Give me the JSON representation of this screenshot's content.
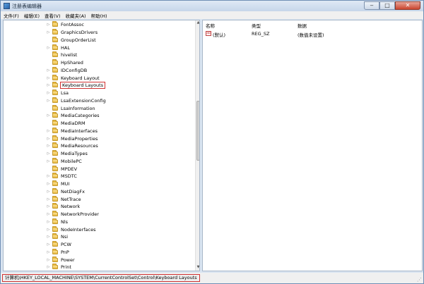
{
  "window": {
    "title": "注册表编辑器",
    "controls": {
      "minimize": "‒",
      "maximize": "□",
      "close": "✕"
    }
  },
  "menu": [
    "文件(F)",
    "编辑(E)",
    "查看(V)",
    "收藏夹(A)",
    "帮助(H)"
  ],
  "tree": {
    "items": [
      {
        "label": "FontAssoc",
        "expandable": true
      },
      {
        "label": "GraphicsDrivers",
        "expandable": true
      },
      {
        "label": "GroupOrderList",
        "expandable": false
      },
      {
        "label": "HAL",
        "expandable": true
      },
      {
        "label": "hivelist",
        "expandable": false
      },
      {
        "label": "HpShared",
        "expandable": false
      },
      {
        "label": "IDConfigDB",
        "expandable": true
      },
      {
        "label": "Keyboard Layout",
        "expandable": true
      },
      {
        "label": "Keyboard Layouts",
        "expandable": true,
        "selected": true
      },
      {
        "label": "Lsa",
        "expandable": true
      },
      {
        "label": "LsaExtensionConfig",
        "expandable": true
      },
      {
        "label": "LsaInformation",
        "expandable": false
      },
      {
        "label": "MediaCategories",
        "expandable": true
      },
      {
        "label": "MediaDRM",
        "expandable": false
      },
      {
        "label": "MediaInterfaces",
        "expandable": true
      },
      {
        "label": "MediaProperties",
        "expandable": true
      },
      {
        "label": "MediaResources",
        "expandable": true
      },
      {
        "label": "MediaTypes",
        "expandable": true
      },
      {
        "label": "MobilePC",
        "expandable": true
      },
      {
        "label": "MPDEV",
        "expandable": false
      },
      {
        "label": "MSDTC",
        "expandable": true
      },
      {
        "label": "MUI",
        "expandable": true
      },
      {
        "label": "NetDiagFx",
        "expandable": true
      },
      {
        "label": "NetTrace",
        "expandable": true
      },
      {
        "label": "Network",
        "expandable": true
      },
      {
        "label": "NetworkProvider",
        "expandable": true
      },
      {
        "label": "Nls",
        "expandable": true
      },
      {
        "label": "NodeInterfaces",
        "expandable": true
      },
      {
        "label": "Nsi",
        "expandable": true
      },
      {
        "label": "PCW",
        "expandable": true
      },
      {
        "label": "PnP",
        "expandable": true
      },
      {
        "label": "Power",
        "expandable": true
      },
      {
        "label": "Print",
        "expandable": true
      }
    ]
  },
  "values": {
    "columns": {
      "name": "名称",
      "type": "类型",
      "data": "数据"
    },
    "rows": [
      {
        "icon": "ab",
        "name": "(默认)",
        "type": "REG_SZ",
        "data": "(数值未设置)"
      }
    ]
  },
  "status": {
    "path": "计算机\\HKEY_LOCAL_MACHINE\\SYSTEM\\CurrentControlSet\\Control\\Keyboard Layouts"
  },
  "colors": {
    "highlight_border": "#d13232",
    "folder": "#e8b83f",
    "frame": "#d9e4f1"
  }
}
